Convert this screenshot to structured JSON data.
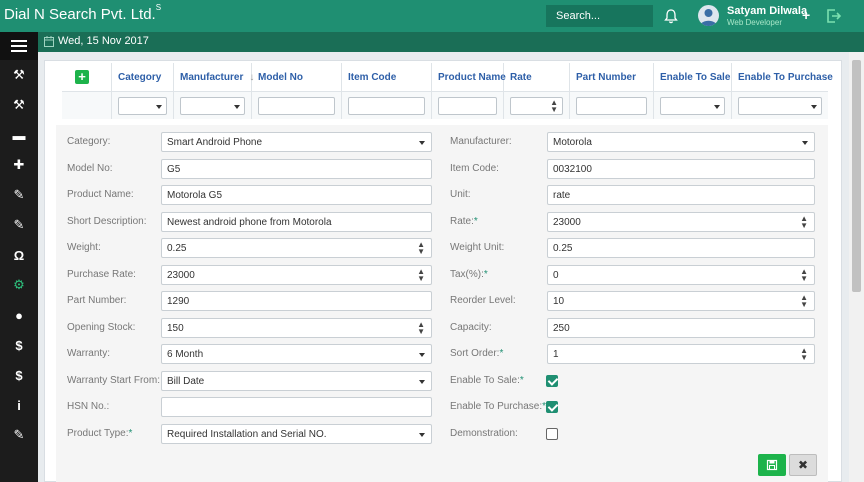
{
  "header": {
    "brand": "Dial N Search Pvt. Ltd.",
    "brand_sup": "S",
    "search_label": "Search...",
    "user_name": "Satyam Dilwala",
    "user_role": "Web Developer",
    "plus_label": "+"
  },
  "subbar": {
    "date": "Wed, 15 Nov 2017"
  },
  "sidebar": {
    "icons": [
      "menu-icon",
      "gavel-icon",
      "gavel-icon",
      "truck-icon",
      "puzzle-icon",
      "wrench-icon",
      "wrench-icon",
      "headphones-icon",
      "cogs-icon",
      "user-icon",
      "dollar-icon",
      "dollar-icon",
      "info-icon",
      "wrench-icon"
    ],
    "glyphs": [
      "≡",
      "⚒",
      "⚒",
      "▬",
      "✚",
      "✎",
      "✎",
      "Ω",
      "⚙",
      "●",
      "$",
      "$",
      "i",
      "✎"
    ]
  },
  "grid": {
    "add_label": "+",
    "columns": [
      {
        "label": "Category",
        "filter": "select"
      },
      {
        "label": "Manufacturer",
        "filter": "select",
        "sort": "↓"
      },
      {
        "label": "Model No",
        "filter": "text"
      },
      {
        "label": "Item Code",
        "filter": "text"
      },
      {
        "label": "Product Name",
        "filter": "text"
      },
      {
        "label": "Rate",
        "filter": "number"
      },
      {
        "label": "Part Number",
        "filter": "text"
      },
      {
        "label": "Enable To Sale",
        "filter": "select"
      },
      {
        "label": "Enable To Purchase",
        "filter": "select"
      }
    ]
  },
  "form": {
    "left": [
      {
        "label": "Category:",
        "value": "Smart Android Phone",
        "type": "select"
      },
      {
        "label": "Model No:",
        "value": "G5",
        "type": "text"
      },
      {
        "label": "Product Name:",
        "value": "Motorola G5",
        "type": "text"
      },
      {
        "label": "Short Description:",
        "value": "Newest android phone from Motorola",
        "type": "text"
      },
      {
        "label": "Weight:",
        "value": "0.25",
        "type": "number"
      },
      {
        "label": "Purchase Rate:",
        "value": "23000",
        "type": "number"
      },
      {
        "label": "Part Number:",
        "value": "1290",
        "type": "text"
      },
      {
        "label": "Opening Stock:",
        "value": "150",
        "type": "number"
      },
      {
        "label": "Warranty:",
        "value": "6 Month",
        "type": "select"
      },
      {
        "label": "Warranty Start From:",
        "value": "Bill Date",
        "type": "select"
      },
      {
        "label": "HSN No.:",
        "value": "",
        "type": "text"
      },
      {
        "label": "Product Type:",
        "required": "*",
        "value": "Required Installation and Serial NO.",
        "type": "select"
      }
    ],
    "right": [
      {
        "label": "Manufacturer:",
        "value": "Motorola",
        "type": "select"
      },
      {
        "label": "Item Code:",
        "value": "0032100",
        "type": "text"
      },
      {
        "label": "Unit:",
        "value": "rate",
        "type": "text"
      },
      {
        "label": "Rate:",
        "required": "*",
        "value": "23000",
        "type": "number"
      },
      {
        "label": "Weight Unit:",
        "value": "0.25",
        "type": "text"
      },
      {
        "label": "Tax(%):",
        "required": "*",
        "value": "0",
        "type": "number"
      },
      {
        "label": "Reorder Level:",
        "value": "10",
        "type": "number"
      },
      {
        "label": "Capacity:",
        "value": "250",
        "type": "text"
      },
      {
        "label": "Sort Order:",
        "required": "*",
        "value": "1",
        "type": "number"
      },
      {
        "label": "Enable To Sale:",
        "required": "*",
        "type": "checkbox",
        "checked": true
      },
      {
        "label": "Enable To Purchase:",
        "required": "*",
        "type": "checkbox",
        "checked": true
      },
      {
        "label": "Demonstration:",
        "type": "checkbox",
        "checked": false
      }
    ]
  },
  "buttons": {
    "cancel_label": "✖"
  },
  "colors": {
    "primary": "#1f8f72",
    "dark": "#1a6e56",
    "sidebar": "#1c1c1c",
    "link": "#2e5fa8",
    "success": "#1db34b"
  }
}
